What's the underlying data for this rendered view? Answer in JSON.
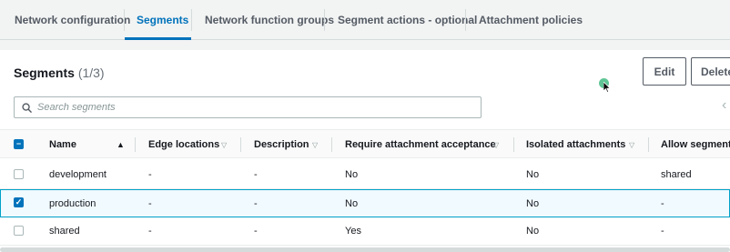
{
  "tabs": [
    {
      "label": "Network configuration",
      "active": false
    },
    {
      "label": "Segments",
      "active": true
    },
    {
      "label": "Network function groups",
      "active": false
    },
    {
      "label": "Segment actions - optional",
      "active": false
    },
    {
      "label": "Attachment policies",
      "active": false
    }
  ],
  "panel": {
    "title": "Segments",
    "count": "(1/3)",
    "edit_label": "Edit",
    "delete_label": "Delete"
  },
  "search": {
    "placeholder": "Search segments"
  },
  "table": {
    "columns": [
      "Name",
      "Edge locations",
      "Description",
      "Require attachment acceptance",
      "Isolated attachments",
      "Allow segment L"
    ],
    "rows": [
      {
        "name": "development",
        "edge": "-",
        "description": "-",
        "require": "No",
        "isolated": "No",
        "allow": "shared",
        "selected": false
      },
      {
        "name": "production",
        "edge": "-",
        "description": "-",
        "require": "No",
        "isolated": "No",
        "allow": "-",
        "selected": true
      },
      {
        "name": "shared",
        "edge": "-",
        "description": "-",
        "require": "Yes",
        "isolated": "No",
        "allow": "-",
        "selected": false
      }
    ]
  },
  "colors": {
    "accent": "#0073bb",
    "selected_row_bg": "#f1faff",
    "selected_row_border": "#00a1c9"
  }
}
